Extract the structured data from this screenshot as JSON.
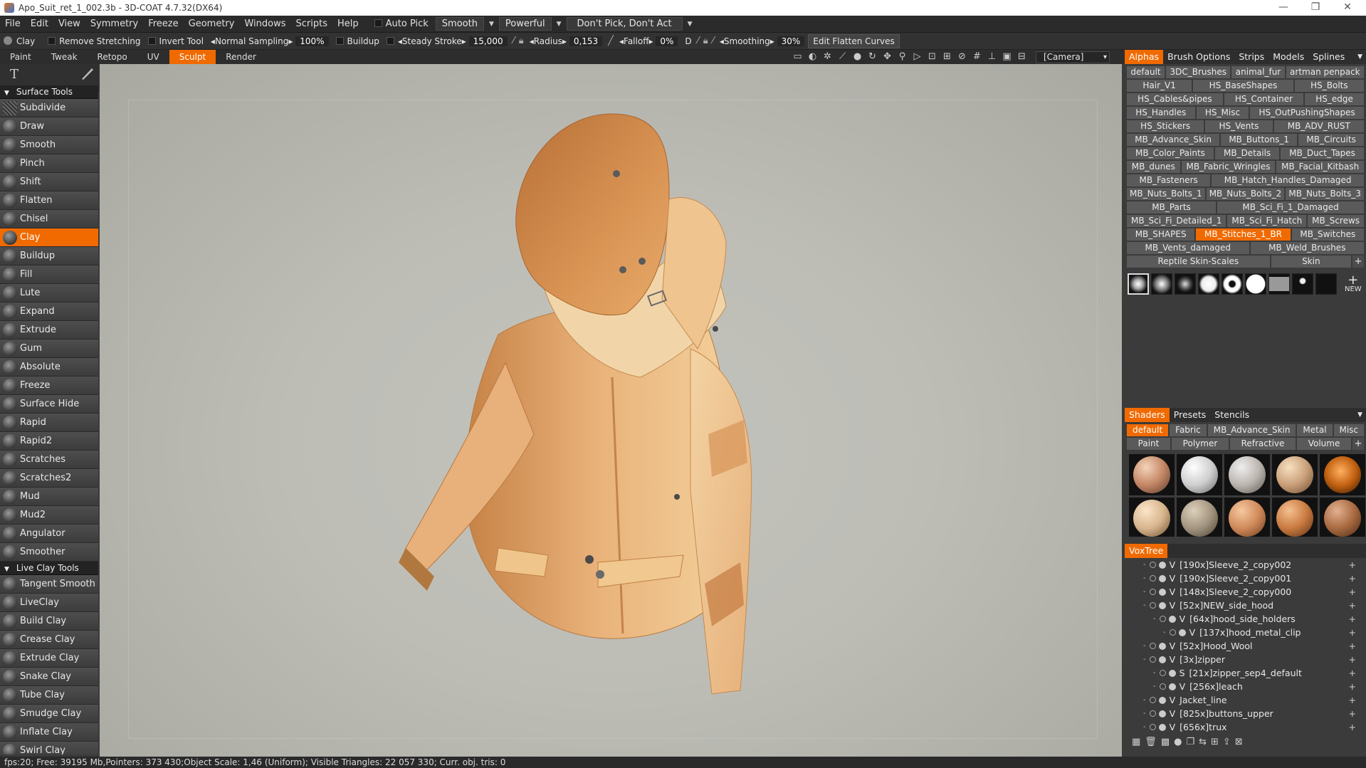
{
  "window": {
    "title": "Apo_Suit_ret_1_002.3b - 3D-COAT 4.7.32(DX64)",
    "minimize": "—",
    "restore": "❐",
    "close": "✕"
  },
  "menubar": {
    "items": [
      "File",
      "Edit",
      "View",
      "Symmetry",
      "Freeze",
      "Geometry",
      "Windows",
      "Scripts",
      "Help"
    ],
    "auto_pick": "Auto Pick",
    "smooth_dd": "Smooth",
    "powerful_dd": "Powerful",
    "pick_dd": "Don't Pick, Don't Act"
  },
  "optionsbar": {
    "tool_name": "Clay",
    "remove_stretching": "Remove Stretching",
    "invert_tool": "Invert Tool",
    "normal_sampling_label": "Normal Sampling",
    "normal_sampling_value": "100%",
    "buildup": "Buildup",
    "steady_stroke_label": "Steady Stroke",
    "steady_stroke_value": "15,000",
    "radius_label": "Radius",
    "radius_value": "0,153",
    "falloff_label": "Falloff",
    "falloff_value": "0%",
    "depth_label": "D",
    "smoothing_label": "Smoothing",
    "smoothing_value": "30%",
    "edit_curves": "Edit Flatten Curves"
  },
  "rooms": {
    "items": [
      "Paint",
      "Tweak",
      "Retopo",
      "UV",
      "Sculpt",
      "Render"
    ],
    "active": "Sculpt",
    "camera": "[Camera]"
  },
  "toolpanel": {
    "surface_header": "Surface Tools",
    "surface_tools": [
      "Subdivide",
      "Draw",
      "Smooth",
      "Pinch",
      "Shift",
      "Flatten",
      "Chisel",
      "Clay",
      "Buildup",
      "Fill",
      "Lute",
      "Expand",
      "Extrude",
      "Gum",
      "Absolute",
      "Freeze",
      "Surface Hide",
      "Rapid",
      "Rapid2",
      "Scratches",
      "Scratches2",
      "Mud",
      "Mud2",
      "Angulator",
      "Smoother"
    ],
    "active_tool": "Clay",
    "live_header": "Live Clay Tools",
    "live_tools": [
      "Tangent Smooth",
      "LiveClay",
      "Build Clay",
      "Crease Clay",
      "Extrude Clay",
      "Snake Clay",
      "Tube Clay",
      "Smudge Clay",
      "Inflate Clay",
      "Swirl Clay"
    ]
  },
  "alphas": {
    "tabs": [
      "Alphas",
      "Brush Options",
      "Strips",
      "Models",
      "Splines"
    ],
    "active_tab": "Alphas",
    "chips": [
      "default",
      "3DC_Brushes",
      "animal_fur",
      "artman penpack",
      "Hair_V1",
      "HS_BaseShapes",
      "HS_Bolts",
      "HS_Cables&pipes",
      "HS_Container",
      "HS_edge",
      "HS_Handles",
      "HS_Misc",
      "HS_OutPushingShapes",
      "HS_Stickers",
      "HS_Vents",
      "MB_ADV_RUST",
      "MB_Advance_Skin",
      "MB_Buttons_1",
      "MB_Circuits",
      "MB_Color_Paints",
      "MB_Details",
      "MB_Duct_Tapes",
      "MB_dunes",
      "MB_Fabric_Wringles",
      "MB_Facial_Kitbash",
      "MB_Fasteners",
      "MB_Hatch_Handles_Damaged",
      "MB_Nuts_Bolts_1",
      "MB_Nuts_Bolts_2",
      "MB_Nuts_Bolts_3",
      "MB_Parts",
      "MB_Sci_Fi_1_Damaged",
      "MB_Sci_Fi_Detailed_1",
      "MB_Sci_Fi_Hatch",
      "MB_Screws",
      "MB_SHAPES",
      "MB_Stitches_1_BR",
      "MB_Switches",
      "MB_Vents_damaged",
      "MB_Weld_Brushes",
      "Reptile Skin-Scales",
      "Skin"
    ],
    "active_chip": "MB_Stitches_1_BR",
    "new_label": "NEW"
  },
  "shaders": {
    "tabs": [
      "Shaders",
      "Presets",
      "Stencils"
    ],
    "active_tab": "Shaders",
    "chips": [
      "default",
      "Fabric",
      "MB_Advance_Skin",
      "Metal",
      "Misc",
      "Paint",
      "Polymer",
      "Refractive",
      "Volume"
    ],
    "active_chip": "default"
  },
  "voxtree": {
    "title": "VoxTree",
    "rows": [
      {
        "indent": 0,
        "type": "V",
        "label": "[190x]Sleeve_2_copy002"
      },
      {
        "indent": 0,
        "type": "V",
        "label": "[190x]Sleeve_2_copy001"
      },
      {
        "indent": 0,
        "type": "V",
        "label": "[148x]Sleeve_2_copy000"
      },
      {
        "indent": 0,
        "type": "V",
        "label": "[52x]NEW_side_hood"
      },
      {
        "indent": 1,
        "type": "V",
        "label": "[64x]hood_side_holders"
      },
      {
        "indent": 2,
        "type": "V",
        "label": "[137x]hood_metal_clip"
      },
      {
        "indent": 0,
        "type": "V",
        "label": "[52x]Hood_Wool"
      },
      {
        "indent": 0,
        "type": "V",
        "label": "[3x]zipper"
      },
      {
        "indent": 1,
        "type": "S",
        "label": "[21x]zipper_sep4_default"
      },
      {
        "indent": 1,
        "type": "V",
        "label": "[256x]leach"
      },
      {
        "indent": 0,
        "type": "V",
        "label": "Jacket_line"
      },
      {
        "indent": 0,
        "type": "V",
        "label": "[825x]buttons_upper"
      },
      {
        "indent": 0,
        "type": "V",
        "label": "[656x]trux"
      }
    ]
  },
  "status": {
    "text": "fps:20;   Free: 39195 Mb,Pointers: 373 430;Object Scale: 1,46 (Uniform); Visible  Triangles: 22 057 330; Curr. obj. tris: 0"
  }
}
